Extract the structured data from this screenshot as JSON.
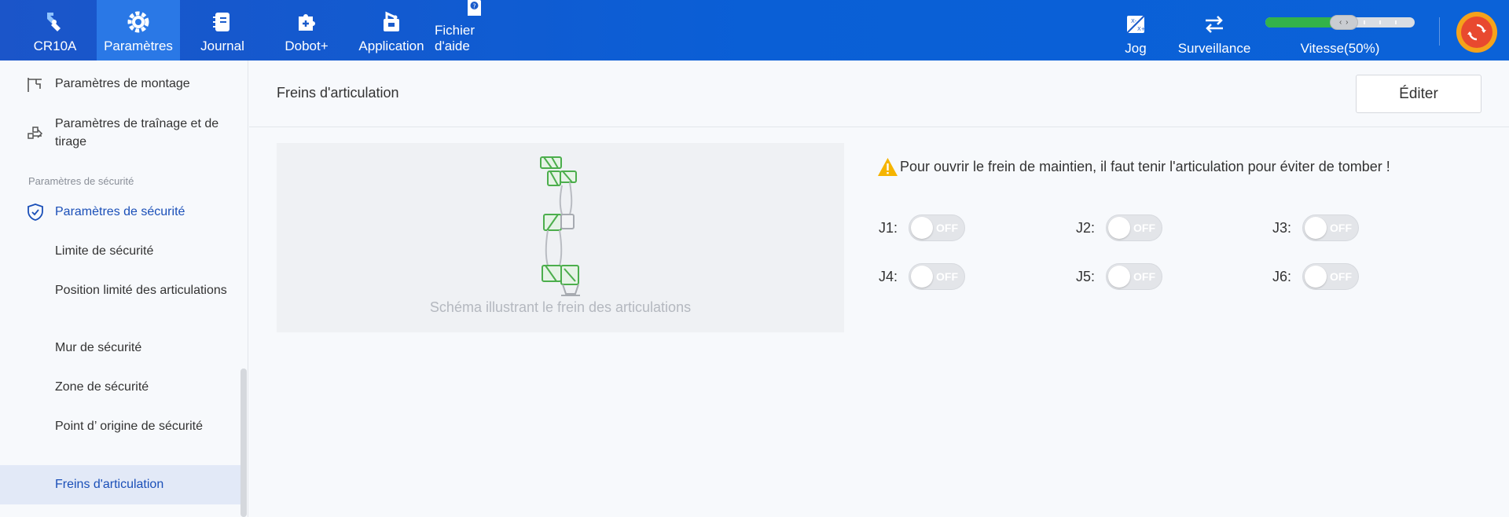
{
  "topbar": {
    "nav": [
      {
        "label": "CR10A",
        "icon": "robot-arm-icon"
      },
      {
        "label": "Paramètres",
        "icon": "gear-icon",
        "active": true
      },
      {
        "label": "Journal",
        "icon": "notebook-icon"
      },
      {
        "label": "Dobot+",
        "icon": "puzzle-plus-icon"
      },
      {
        "label": "Application",
        "icon": "app-tool-icon"
      },
      {
        "label": "Fichier d'aide",
        "icon": "help-file-icon"
      }
    ],
    "jog": {
      "label": "Jog",
      "icon": "jog-icon"
    },
    "surveillance": {
      "label": "Surveillance",
      "icon": "swap-arrows-icon"
    },
    "speed": {
      "label": "Vitesse(50%)",
      "value_percent": 50,
      "knob": "‹ ›"
    },
    "accent": "#0a5fd6"
  },
  "sidebar": {
    "items": [
      {
        "label": "Paramètres de montage",
        "icon": "mount-icon"
      },
      {
        "label": "Paramètres de traînage et de tirage",
        "icon": "drag-icon"
      }
    ],
    "group_label": "Paramètres de sécurité",
    "section": {
      "label": "Paramètres de sécurité",
      "icon": "shield-check-icon"
    },
    "sub_items": [
      {
        "label": "Limite de sécurité"
      },
      {
        "label": "Position limité des articulations"
      },
      {
        "label": "Mur de sécurité"
      },
      {
        "label": "Zone de sécurité"
      },
      {
        "label": "Point d’ origine de sécurité"
      },
      {
        "label": "Freins d'articulation",
        "selected": true
      }
    ]
  },
  "content": {
    "title": "Freins d'articulation",
    "edit_label": "Éditer",
    "diagram_caption": "Schéma illustrant le frein des articulations",
    "warning": "Pour ouvrir le frein de maintien, il faut tenir l'articulation pour éviter de tomber !",
    "joints": [
      {
        "label": "J1:",
        "state": "OFF"
      },
      {
        "label": "J2:",
        "state": "OFF"
      },
      {
        "label": "J3:",
        "state": "OFF"
      },
      {
        "label": "J4:",
        "state": "OFF"
      },
      {
        "label": "J5:",
        "state": "OFF"
      },
      {
        "label": "J6:",
        "state": "OFF"
      }
    ]
  }
}
